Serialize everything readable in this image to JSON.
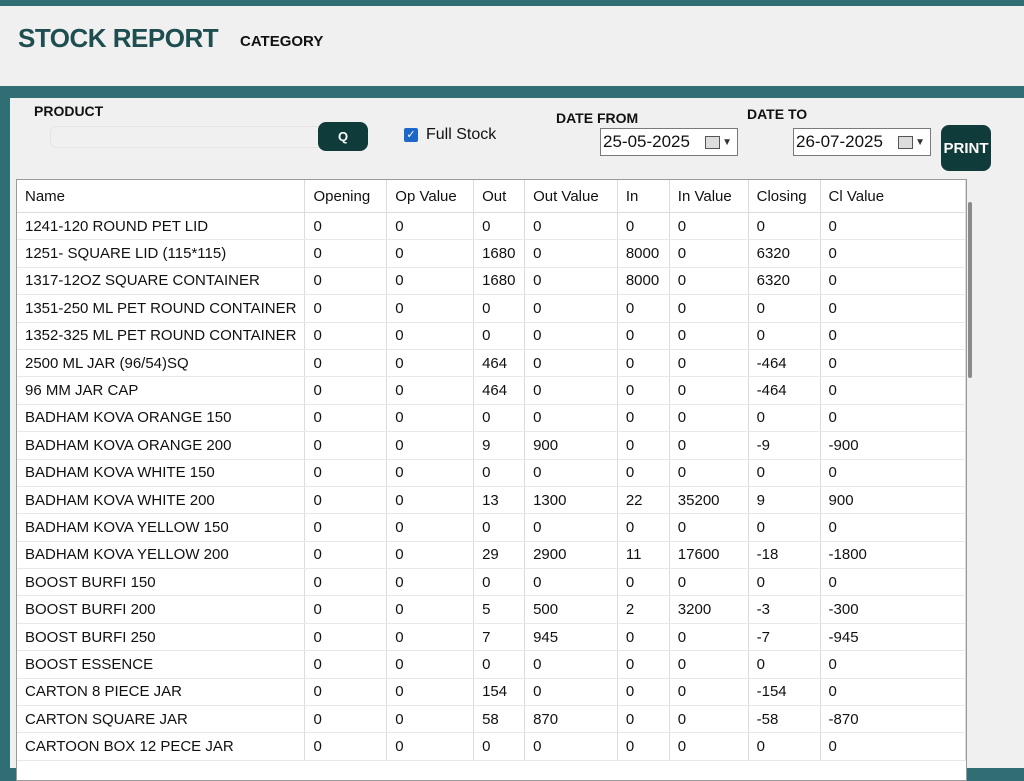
{
  "header": {
    "title": "STOCK REPORT",
    "category_label": "CATEGORY"
  },
  "filters": {
    "product_label": "PRODUCT",
    "product_value": "",
    "search_button": "Q",
    "full_stock_label": "Full Stock",
    "full_stock_checked": true,
    "date_from_label": "DATE FROM",
    "date_from_value": "25-05-2025",
    "date_to_label": "DATE TO",
    "date_to_value": "26-07-2025",
    "print_button": "PRINT"
  },
  "table": {
    "columns": [
      "Name",
      "Opening",
      "Op Value",
      "Out",
      "Out Value",
      "In",
      "In Value",
      "Closing",
      "Cl Value"
    ],
    "rows": [
      [
        "1241-120 ROUND PET LID",
        "0",
        "0",
        "0",
        "0",
        "0",
        "0",
        "0",
        "0"
      ],
      [
        "1251- SQUARE LID (115*115)",
        "0",
        "0",
        "1680",
        "0",
        "8000",
        "0",
        "6320",
        "0"
      ],
      [
        "1317-12OZ SQUARE CONTAINER",
        "0",
        "0",
        "1680",
        "0",
        "8000",
        "0",
        "6320",
        "0"
      ],
      [
        "1351-250 ML PET ROUND CONTAINER",
        "0",
        "0",
        "0",
        "0",
        "0",
        "0",
        "0",
        "0"
      ],
      [
        "1352-325 ML PET ROUND CONTAINER",
        "0",
        "0",
        "0",
        "0",
        "0",
        "0",
        "0",
        "0"
      ],
      [
        "2500 ML JAR (96/54)SQ",
        "0",
        "0",
        "464",
        "0",
        "0",
        "0",
        "-464",
        "0"
      ],
      [
        "96 MM JAR CAP",
        "0",
        "0",
        "464",
        "0",
        "0",
        "0",
        "-464",
        "0"
      ],
      [
        "BADHAM KOVA ORANGE 150",
        "0",
        "0",
        "0",
        "0",
        "0",
        "0",
        "0",
        "0"
      ],
      [
        "BADHAM KOVA ORANGE 200",
        "0",
        "0",
        "9",
        "900",
        "0",
        "0",
        "-9",
        "-900"
      ],
      [
        "BADHAM KOVA WHITE 150",
        "0",
        "0",
        "0",
        "0",
        "0",
        "0",
        "0",
        "0"
      ],
      [
        "BADHAM KOVA WHITE 200",
        "0",
        "0",
        "13",
        "1300",
        "22",
        "35200",
        "9",
        "900"
      ],
      [
        "BADHAM KOVA YELLOW 150",
        "0",
        "0",
        "0",
        "0",
        "0",
        "0",
        "0",
        "0"
      ],
      [
        "BADHAM KOVA YELLOW 200",
        "0",
        "0",
        "29",
        "2900",
        "11",
        "17600",
        "-18",
        "-1800"
      ],
      [
        "BOOST BURFI 150",
        "0",
        "0",
        "0",
        "0",
        "0",
        "0",
        "0",
        "0"
      ],
      [
        "BOOST BURFI 200",
        "0",
        "0",
        "5",
        "500",
        "2",
        "3200",
        "-3",
        "-300"
      ],
      [
        "BOOST BURFI 250",
        "0",
        "0",
        "7",
        "945",
        "0",
        "0",
        "-7",
        "-945"
      ],
      [
        "BOOST ESSENCE",
        "0",
        "0",
        "0",
        "0",
        "0",
        "0",
        "0",
        "0"
      ],
      [
        "CARTON 8 PIECE JAR",
        "0",
        "0",
        "154",
        "0",
        "0",
        "0",
        "-154",
        "0"
      ],
      [
        "CARTON SQUARE JAR",
        "0",
        "0",
        "58",
        "870",
        "0",
        "0",
        "-58",
        "-870"
      ],
      [
        "CARTOON BOX 12 PECE JAR",
        "0",
        "0",
        "0",
        "0",
        "0",
        "0",
        "0",
        "0"
      ]
    ]
  },
  "colors": {
    "header_teal": "#2f6f73",
    "button_dark": "#0f3b3a",
    "title_color": "#1e4e50"
  }
}
